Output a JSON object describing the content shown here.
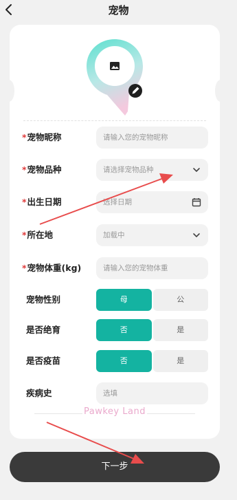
{
  "header": {
    "title": "宠物"
  },
  "form": {
    "nickname": {
      "label": "宠物昵称",
      "placeholder": "请输入您的宠物昵称"
    },
    "breed": {
      "label": "宠物品种",
      "placeholder": "请选择宠物品种"
    },
    "birthday": {
      "label": "出生日期",
      "placeholder": "选择日期"
    },
    "location": {
      "label": "所在地",
      "value": "加载中"
    },
    "weight": {
      "label": "宠物体重(kg)",
      "placeholder": "请输入您的宠物体重"
    },
    "gender": {
      "label": "宠物性别",
      "options": [
        "母",
        "公"
      ],
      "selected": "母"
    },
    "neutered": {
      "label": "是否绝育",
      "options": [
        "否",
        "是"
      ],
      "selected": "否"
    },
    "vaccinated": {
      "label": "是否疫苗",
      "options": [
        "否",
        "是"
      ],
      "selected": "否"
    },
    "disease": {
      "label": "疾病史",
      "placeholder": "选填"
    },
    "required_mark": "*"
  },
  "brand": "Pawkey Land",
  "footer": {
    "next_label": "下一步"
  },
  "colors": {
    "accent": "#14b3a1",
    "button": "#3a3a3a",
    "required": "#e03a3a",
    "annotation": "#e84c4c"
  }
}
